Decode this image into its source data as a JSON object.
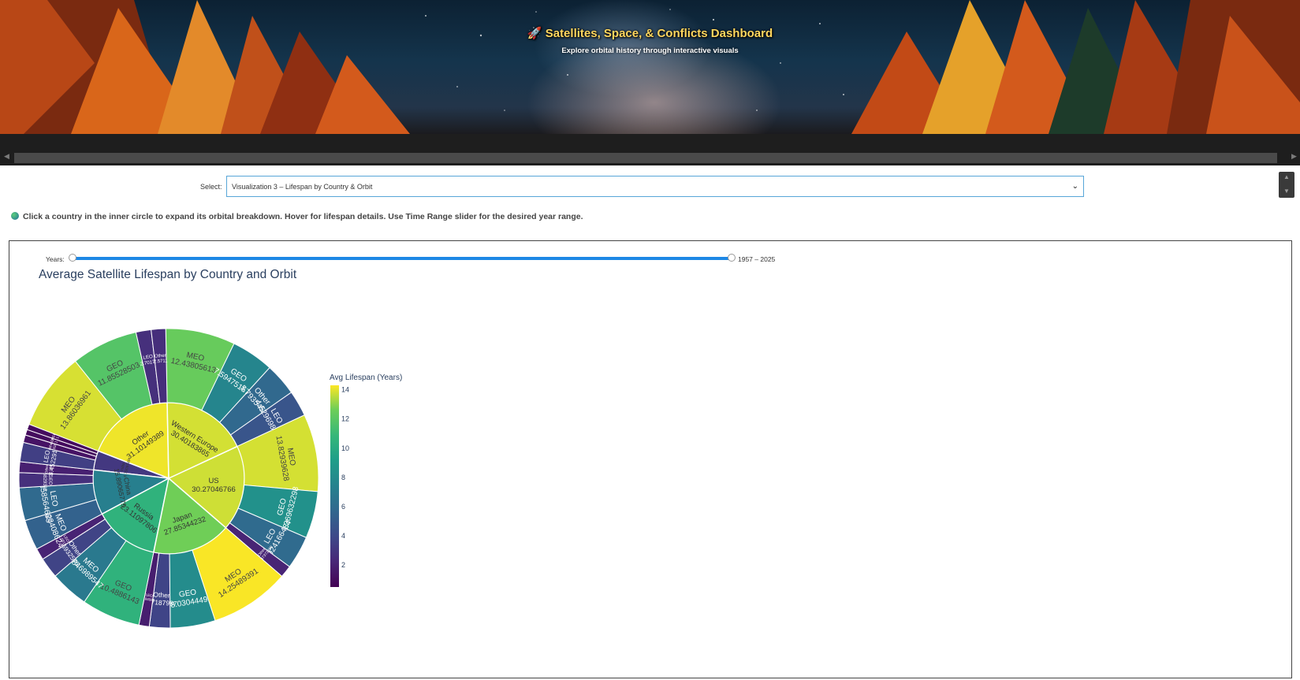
{
  "header": {
    "title": "Satellites, Space, & Conflicts Dashboard",
    "subtitle": "Explore orbital history through interactive visuals",
    "title_icon": "rocket-icon"
  },
  "selector": {
    "label": "Select:",
    "value": "Visualization 3 – Lifespan by Country & Orbit"
  },
  "hint": {
    "icon": "globe-icon",
    "text": "Click a country in the inner circle to expand its orbital breakdown. Hover for lifespan details. Use Time Range slider for the desired year range."
  },
  "slider": {
    "label": "Years:",
    "min": 1957,
    "max": 2025,
    "start": 1957,
    "end": 2025,
    "value_text": "1957 – 2025"
  },
  "chart_data": {
    "type": "sunburst",
    "title": "Average Satellite Lifespan by Country and Orbit",
    "colorbar": {
      "title": "Avg Lifespan (Years)",
      "range": [
        0.5,
        14.3
      ],
      "ticks": [
        2,
        4,
        6,
        8,
        10,
        12,
        14
      ],
      "colorscale": "viridis"
    },
    "countries": [
      {
        "name": "Western Europe",
        "label": "30.40183865",
        "value": 30.40183865,
        "children": [
          {
            "name": "MEO",
            "value": 12.43805613
          },
          {
            "name": "GEO",
            "value": 7.594751679
          },
          {
            "name": "Other",
            "value": 5.79354552
          },
          {
            "name": "LEO",
            "value": 4.629698291
          }
        ]
      },
      {
        "name": "US",
        "label": "30.27046766",
        "value": 30.27046766,
        "children": [
          {
            "name": "MEO",
            "value": 13.82939628
          },
          {
            "name": "GEO",
            "value": 8.369632298
          },
          {
            "name": "LEO",
            "value": 5.924166484
          },
          {
            "name": "Other",
            "value": 2.147372388
          }
        ]
      },
      {
        "name": "Japan",
        "label": "27.85344232",
        "value": 27.85344232,
        "children": [
          {
            "name": "MEO",
            "value": 14.25489391
          },
          {
            "name": "GEO",
            "value": 8.0304449
          },
          {
            "name": "Other",
            "value": 3.7187987
          },
          {
            "name": "LEO",
            "value": 1.84985
          }
        ]
      },
      {
        "name": "Russia",
        "label": "23.11097806",
        "value": 23.11097806,
        "children": [
          {
            "name": "GEO",
            "value": 10.4886143
          },
          {
            "name": "MEO",
            "value": 6.846989547
          },
          {
            "name": "Other",
            "value": 3.6932575
          },
          {
            "name": "LEO",
            "value": 2.0815
          }
        ]
      },
      {
        "name": "China",
        "label": "15.89065775",
        "value": 15.89065775,
        "children": [
          {
            "name": "MEO",
            "value": 5.423408624
          },
          {
            "name": "LEO",
            "value": 5.858564685
          },
          {
            "name": "GEO",
            "value": 2.6829313
          },
          {
            "name": "Other",
            "value": 1.926
          }
        ]
      },
      {
        "name": "India",
        "label": "6.7909749",
        "value": 6.7909749,
        "children": [
          {
            "name": "LEO",
            "value": 3.452291412
          },
          {
            "name": "Other",
            "value": 1.3383
          },
          {
            "name": "GEO",
            "value": 1.0
          },
          {
            "name": "MEO",
            "value": 1.0
          }
        ]
      },
      {
        "name": "Other",
        "label": "31.10149389",
        "value": 31.10149389,
        "children": [
          {
            "name": "MEO",
            "value": 13.86036961
          },
          {
            "name": "GEO",
            "value": 11.85528503
          },
          {
            "name": "LEO",
            "value": 2.70172
          },
          {
            "name": "Other",
            "value": 2.5711
          }
        ]
      }
    ]
  }
}
